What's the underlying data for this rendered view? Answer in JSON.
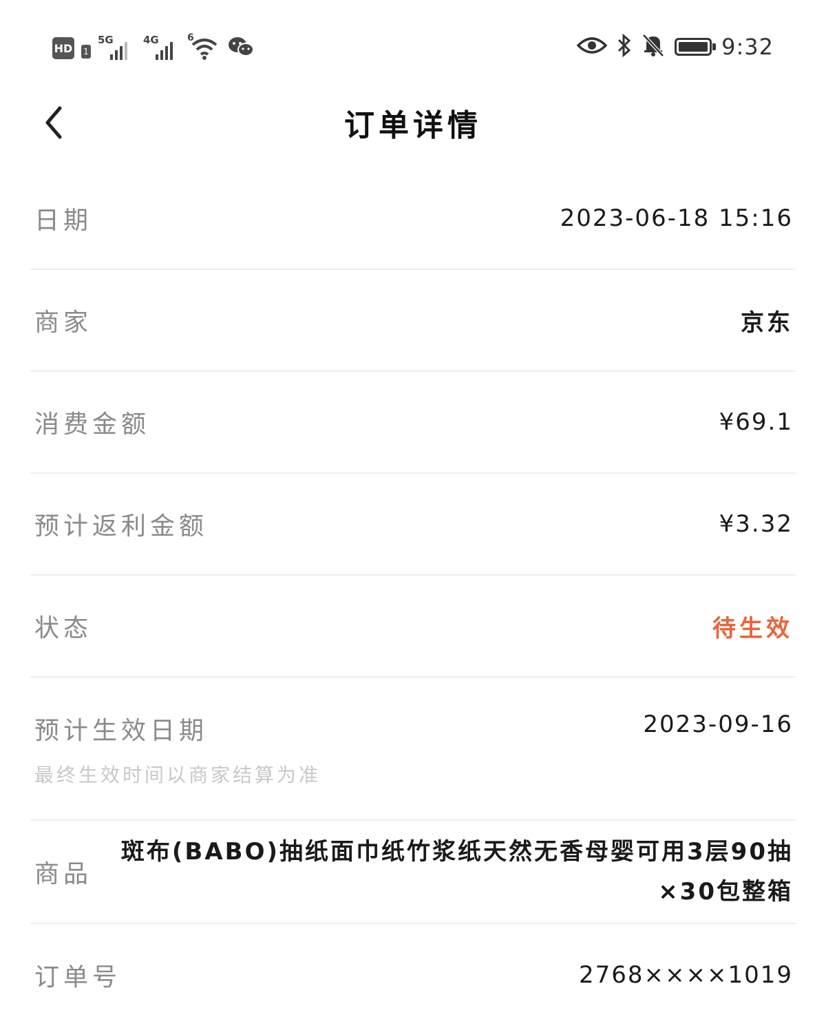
{
  "status_bar": {
    "hd_label": "HD",
    "sim_label": "1",
    "net1_label": "5G",
    "net2_label": "4G",
    "wifi_label": "6",
    "time": "9:32"
  },
  "header": {
    "title": "订单详情"
  },
  "rows": {
    "date": {
      "label": "日期",
      "value": "2023-06-18 15:16"
    },
    "merchant": {
      "label": "商家",
      "value": "京东"
    },
    "amount": {
      "label": "消费金额",
      "value": "¥69.1"
    },
    "rebate": {
      "label": "预计返利金额",
      "value": "¥3.32"
    },
    "status": {
      "label": "状态",
      "value": "待生效",
      "color": "#e8643c"
    },
    "effective": {
      "label": "预计生效日期",
      "sub": "最终生效时间以商家结算为准",
      "value": "2023-09-16"
    },
    "product": {
      "label": "商品",
      "value": "斑布(BABO)抽纸面巾纸竹浆纸天然无香母婴可用3层90抽×30包整箱"
    },
    "order_no": {
      "label": "订单号",
      "value": "2768××××1019"
    }
  }
}
